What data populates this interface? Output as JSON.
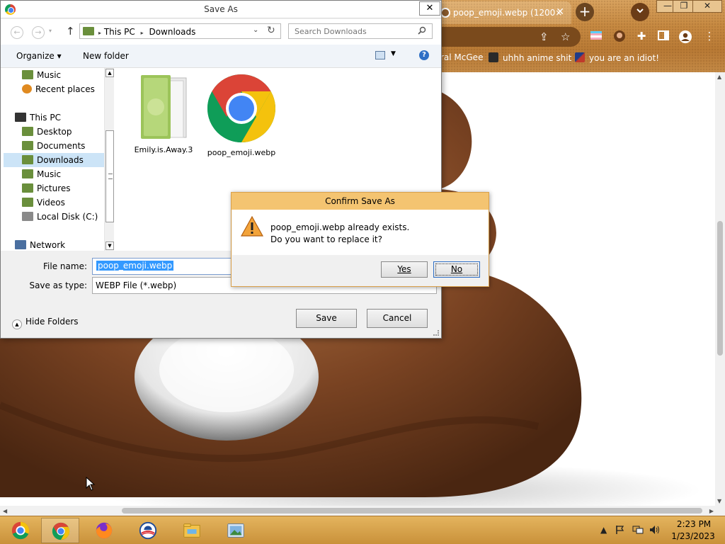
{
  "browser": {
    "tab_title": "poop_emoji.webp (1200×",
    "tab_close": "✕",
    "new_tab": "+",
    "window_controls": [
      "—",
      "❐",
      "✕"
    ],
    "bookmarks": [
      {
        "label": "ral McGee",
        "color": "#ffffff"
      },
      {
        "label": "uhhh anime shit",
        "color": "#2a2a2a"
      },
      {
        "label": "you are an idiot!",
        "color": "#c0392b"
      }
    ]
  },
  "save_as": {
    "title": "Save As",
    "close": "✕",
    "address": [
      "This PC",
      "Downloads"
    ],
    "address_sep": "▸",
    "search_placeholder": "Search Downloads",
    "organize": "Organize ▾",
    "new_folder": "New folder",
    "help": "?",
    "tree": [
      {
        "label": "Music",
        "icon": "music-folder",
        "color": "#6a8f3c"
      },
      {
        "label": "Recent places",
        "icon": "recent-places",
        "color": "#e08a20"
      },
      {
        "label": "This PC",
        "icon": "computer",
        "color": "#333333"
      },
      {
        "label": "Desktop",
        "icon": "desktop-folder",
        "color": "#6a8f3c"
      },
      {
        "label": "Documents",
        "icon": "documents-folder",
        "color": "#6a8f3c"
      },
      {
        "label": "Downloads",
        "icon": "downloads-folder",
        "color": "#6a8f3c"
      },
      {
        "label": "Music",
        "icon": "music-folder",
        "color": "#6a8f3c"
      },
      {
        "label": "Pictures",
        "icon": "pictures-folder",
        "color": "#6a8f3c"
      },
      {
        "label": "Videos",
        "icon": "videos-folder",
        "color": "#6a8f3c"
      },
      {
        "label": "Local Disk (C:)",
        "icon": "disk",
        "color": "#8a8a8a"
      },
      {
        "label": "Network",
        "icon": "network",
        "color": "#4a6fa0"
      }
    ],
    "files": [
      {
        "label": "Emily.is.Away.3",
        "icon": "folder-icon"
      },
      {
        "label": "poop_emoji.webp",
        "icon": "chrome-icon"
      }
    ],
    "file_name_label": "File name:",
    "file_name_value": "poop_emoji.webp",
    "save_type_label": "Save as type:",
    "save_type_value": "WEBP File (*.webp)",
    "hide_folders": "Hide Folders",
    "save_button": "Save",
    "cancel_button": "Cancel"
  },
  "confirm": {
    "title": "Confirm Save As",
    "message_line1": "poop_emoji.webp already exists.",
    "message_line2": "Do you want to replace it?",
    "yes": "Yes",
    "no": "No"
  },
  "taskbar": {
    "apps": [
      "start",
      "chrome",
      "firefox",
      "obama",
      "file-explorer",
      "photos"
    ],
    "time": "2:23 PM",
    "date": "1/23/2023"
  },
  "colors": {
    "chrome_frame": "#c78a42",
    "taskbar": "#d9a44d",
    "selection": "#3399ff",
    "confirm_title": "#f4c471"
  }
}
